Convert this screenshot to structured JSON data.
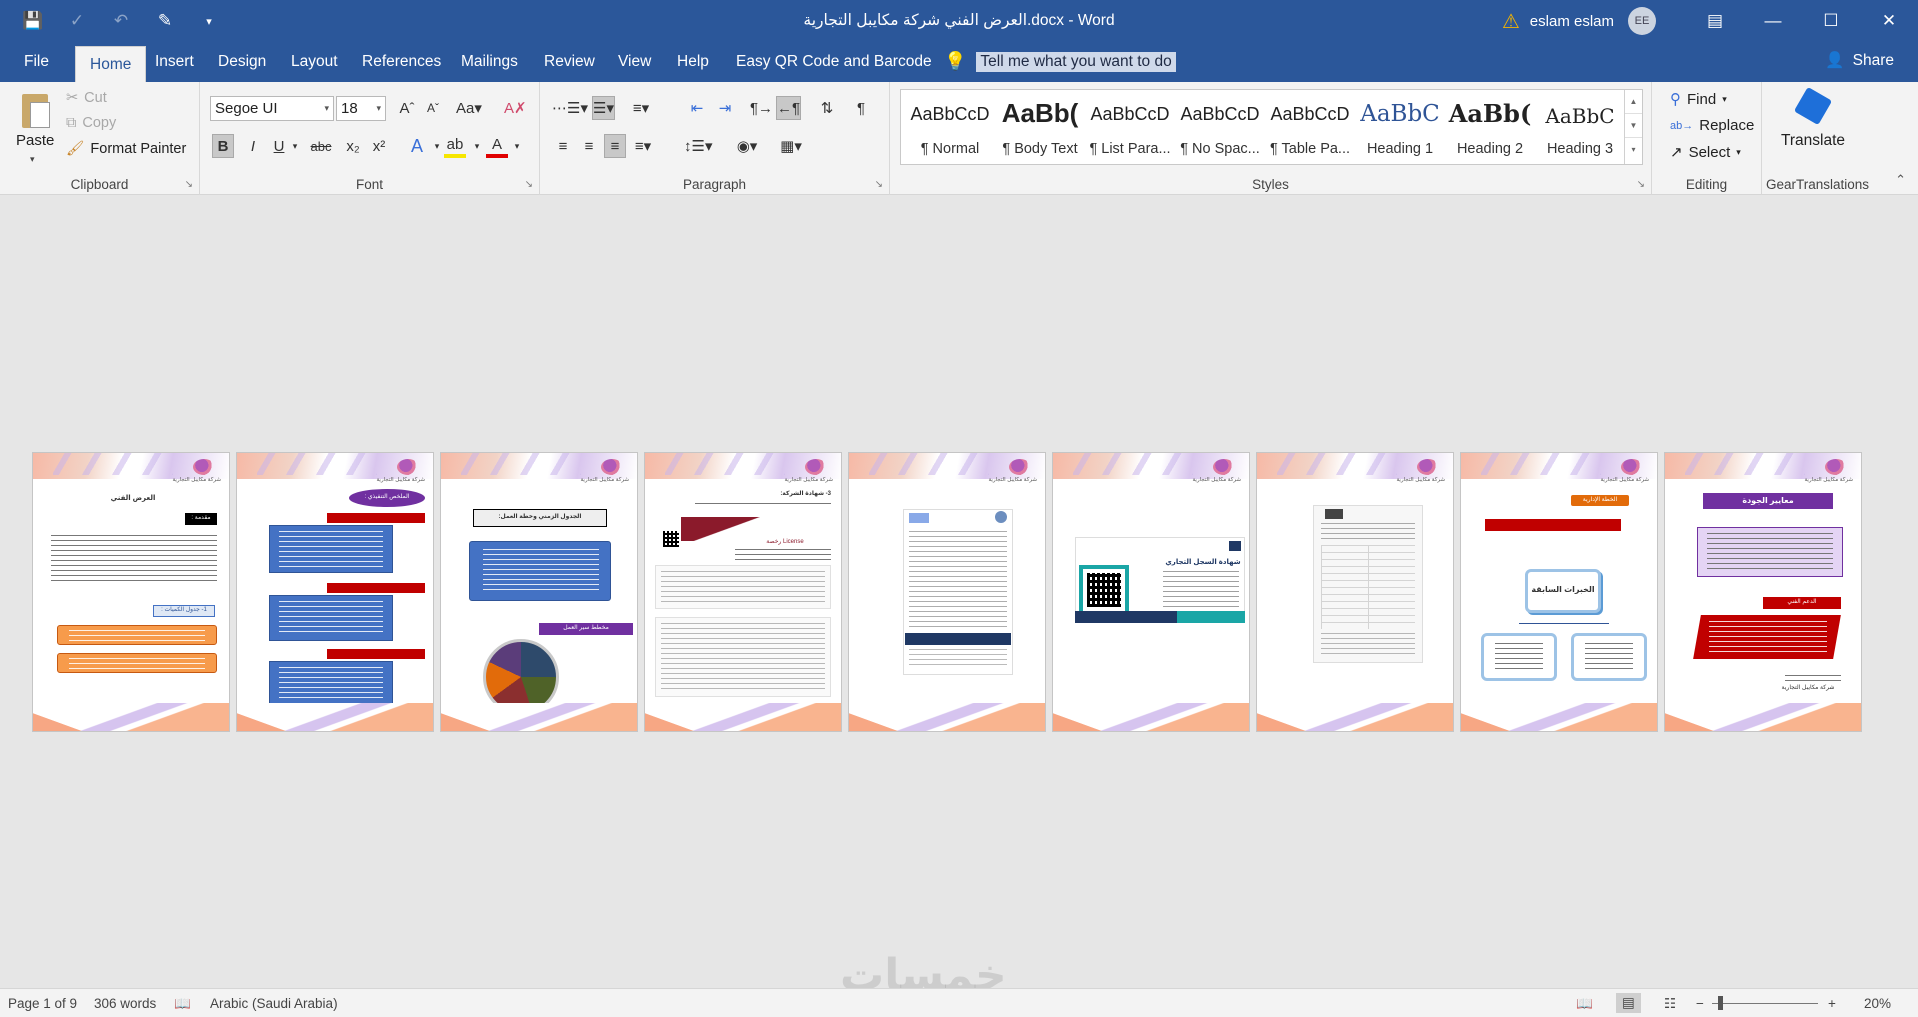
{
  "title_bar": {
    "document_title": "العرض الفني شركة مكايبل التجارية.docx  -  Word",
    "warning_icon": "warning-icon",
    "user_name": "eslam eslam",
    "avatar_initials": "EE"
  },
  "tabs": [
    "File",
    "Home",
    "Insert",
    "Design",
    "Layout",
    "References",
    "Mailings",
    "Review",
    "View",
    "Help",
    "Easy QR Code and Barcode"
  ],
  "active_tab": "Home",
  "tell_me": "Tell me what you want to do",
  "share": "Share",
  "clipboard": {
    "paste": "Paste",
    "cut": "Cut",
    "copy": "Copy",
    "format_painter": "Format Painter",
    "label": "Clipboard"
  },
  "font": {
    "name": "Segoe UI",
    "size": "18",
    "label": "Font"
  },
  "paragraph": {
    "label": "Paragraph"
  },
  "styles": {
    "label": "Styles",
    "items": [
      {
        "preview": "AaBbCcD",
        "name": "¶ Normal"
      },
      {
        "preview": "AaBb(",
        "name": "¶ Body Text"
      },
      {
        "preview": "AaBbCcD",
        "name": "¶ List Para..."
      },
      {
        "preview": "AaBbCcD",
        "name": "¶ No Spac..."
      },
      {
        "preview": "AaBbCcD",
        "name": "¶ Table Pa..."
      },
      {
        "preview": "AaBbC",
        "name": "Heading 1"
      },
      {
        "preview": "AaBb(",
        "name": "Heading 2"
      },
      {
        "preview": "AaBbC",
        "name": "Heading 3"
      }
    ]
  },
  "editing": {
    "find": "Find",
    "replace": "Replace",
    "select": "Select",
    "label": "Editing"
  },
  "gear_translations": {
    "translate": "Translate",
    "label": "GearTranslations"
  },
  "pages": {
    "p1": {
      "header": "شركة مكايبل التجارية",
      "title": "العرض الفني",
      "intro": "مقدمة :",
      "section": "1- جدول الكميات :"
    },
    "p2": {
      "header": "شركة مكايبل التجارية",
      "banner": "الملخص التنفيذي :"
    },
    "p3": {
      "header": "شركة مكايبل التجارية",
      "box": "الجدول الزمني وخطة العمل:",
      "section": "مخطط سير العمل"
    },
    "p4": {
      "header": "شركة مكايبل التجارية",
      "title": "3- شهادة الشركة:",
      "license": "License رخصة"
    },
    "p5": {
      "header": "شركة مكايبل التجارية"
    },
    "p6": {
      "header": "شركة مكايبل التجارية",
      "title": "شهادة السجل التجاري"
    },
    "p7": {
      "header": "شركة مكايبل التجارية"
    },
    "p8": {
      "header": "شركة مكايبل التجارية",
      "tag": "الخطة الإدارية",
      "center": "الخبرات السابقة"
    },
    "p9": {
      "header": "شركة مكايبل التجارية",
      "title": "معايير الجودة",
      "support": "الدعم الفني",
      "sign": "شركة مكايبل التجارية"
    }
  },
  "status_bar": {
    "page": "Page 1 of 9",
    "words": "306 words",
    "language": "Arabic (Saudi Arabia)",
    "zoom": "20%"
  },
  "watermark": "خمسات"
}
